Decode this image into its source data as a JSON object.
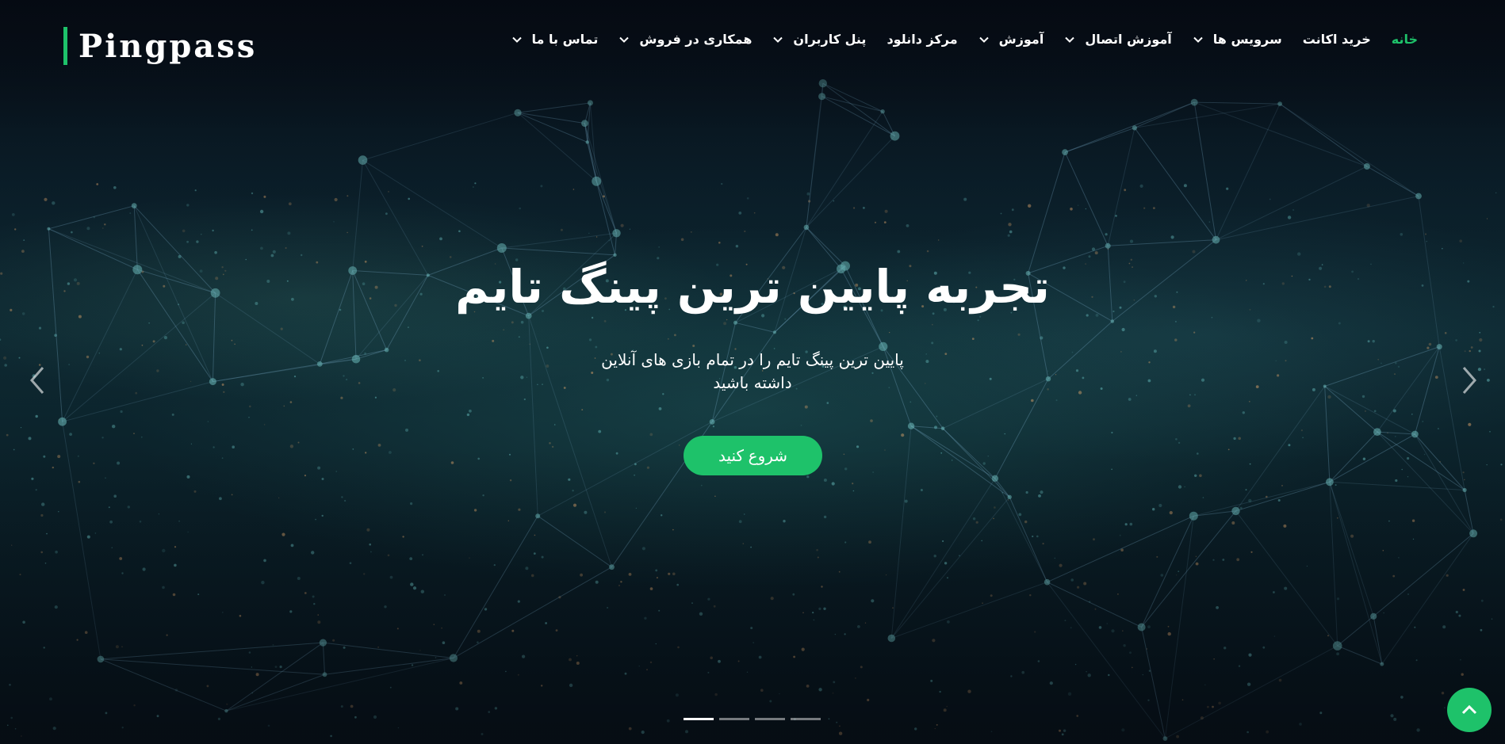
{
  "brand": {
    "logo_text": "Pingpass",
    "accent_color": "#1ec26a"
  },
  "nav": {
    "items": [
      {
        "label": "خانه",
        "active": true,
        "has_dropdown": false
      },
      {
        "label": "خرید اکانت",
        "active": false,
        "has_dropdown": false
      },
      {
        "label": "سرویس ها",
        "active": false,
        "has_dropdown": true
      },
      {
        "label": "آموزش اتصال",
        "active": false,
        "has_dropdown": true
      },
      {
        "label": "آموزش",
        "active": false,
        "has_dropdown": true
      },
      {
        "label": "مرکز دانلود",
        "active": false,
        "has_dropdown": false
      },
      {
        "label": "پنل کاربران",
        "active": false,
        "has_dropdown": true
      },
      {
        "label": "همکاری در فروش",
        "active": false,
        "has_dropdown": true
      },
      {
        "label": "تماس با ما",
        "active": false,
        "has_dropdown": true
      }
    ]
  },
  "hero": {
    "title": "تجربه پایین ترین پینگ تایم",
    "subtitle_line1": "پایین ترین پینگ تایم را در تمام بازی های آنلاین",
    "subtitle_line2": "داشته باشید",
    "cta_label": "شروع کنید"
  },
  "carousel": {
    "slide_count": 4,
    "active_index": 0,
    "prev_icon": "chevron-left-icon",
    "next_icon": "chevron-right-icon"
  },
  "scroll_top": {
    "icon": "chevron-up-icon"
  }
}
